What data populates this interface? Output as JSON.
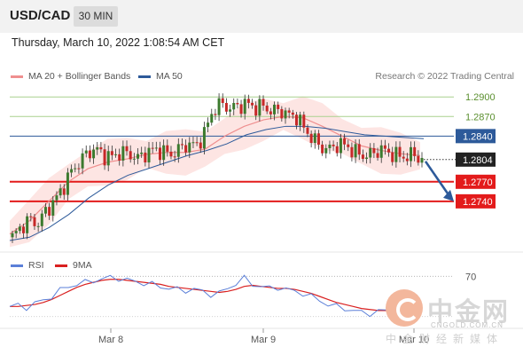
{
  "header": {
    "symbol": "USD/CAD",
    "timeframe": "30 MIN"
  },
  "datetime": "Thursday, March 10, 2022 1:08:54 AM CET",
  "legend": {
    "ma20_label": "MA 20 + Bollinger Bands",
    "ma50_label": "MA 50",
    "rsi_label": "RSI",
    "rsi_ma_label": "9MA"
  },
  "credit": "Research © 2022 Trading Central",
  "watermark": {
    "cn": "中金网",
    "site": "CNGOLD.COM.CN",
    "sub": "中金财经新媒体"
  },
  "colors": {
    "ma20": "#ef8f8f",
    "ma50": "#2d5a9a",
    "bollinger_fill": "#fde0de",
    "resistance_green": "#a9d18e",
    "support_red": "#e31b1b",
    "level_blue": "#2d5a9a",
    "rsi": "#5b7fd8",
    "rsi_ma": "#d92020",
    "arrow": "#2d5a9a"
  },
  "chart_data": [
    {
      "type": "candlestick",
      "title": "USD/CAD 30 MIN",
      "x_tick_labels": [
        "Mar 8",
        "Mar 9",
        "Mar 10"
      ],
      "ylim": [
        1.2665,
        1.2918
      ],
      "last_price": 1.2804,
      "levels": [
        {
          "value": 1.29,
          "label": "1.2900",
          "role": "resistance",
          "color": "#a9d18e"
        },
        {
          "value": 1.287,
          "label": "1.2870",
          "role": "resistance",
          "color": "#a9d18e"
        },
        {
          "value": 1.284,
          "label": "1.2840",
          "role": "pivot",
          "color": "#2d5a9a"
        },
        {
          "value": 1.277,
          "label": "1.2770",
          "role": "support",
          "color": "#e31b1b"
        },
        {
          "value": 1.274,
          "label": "1.2740",
          "role": "support",
          "color": "#e31b1b"
        }
      ],
      "price_path": [
        1.2685,
        1.27,
        1.2712,
        1.2705,
        1.2725,
        1.274,
        1.276,
        1.2785,
        1.28,
        1.2815,
        1.282,
        1.281,
        1.2808,
        1.2816,
        1.2812,
        1.2806,
        1.2814,
        1.282,
        1.2816,
        1.2812,
        1.282,
        1.2828,
        1.2825,
        1.2845,
        1.288,
        1.289,
        1.2882,
        1.2886,
        1.289,
        1.2884,
        1.2886,
        1.2878,
        1.288,
        1.2872,
        1.287,
        1.285,
        1.2835,
        1.2822,
        1.282,
        1.2828,
        1.2825,
        1.2815,
        1.281,
        1.2812,
        1.282,
        1.2815,
        1.281,
        1.2808,
        1.2812,
        1.2804
      ],
      "ma20_path": [
        1.269,
        1.271,
        1.274,
        1.277,
        1.279,
        1.28,
        1.2805,
        1.2812,
        1.2815,
        1.2815,
        1.282,
        1.284,
        1.2855,
        1.2865,
        1.287,
        1.2868,
        1.2855,
        1.284,
        1.2825,
        1.2818,
        1.2813,
        1.281
      ],
      "ma50_path": [
        1.268,
        1.2685,
        1.27,
        1.272,
        1.2745,
        1.2765,
        1.278,
        1.279,
        1.28,
        1.281,
        1.2818,
        1.2828,
        1.2842,
        1.285,
        1.2855,
        1.2855,
        1.2852,
        1.2847,
        1.2842,
        1.284,
        1.2838,
        1.2836
      ],
      "forecast_arrow": {
        "from": 1.2804,
        "to": 1.274
      }
    },
    {
      "type": "line",
      "title": "RSI",
      "series": [
        {
          "name": "RSI"
        },
        {
          "name": "9MA"
        }
      ],
      "ylim": [
        20,
        80
      ],
      "levels": [
        {
          "value": 70,
          "label": "70"
        }
      ],
      "rsi_values": [
        40,
        41,
        39,
        43,
        46,
        50,
        56,
        60,
        62,
        64,
        66,
        67,
        69,
        68,
        66,
        65,
        63,
        62,
        60,
        58,
        57,
        56,
        57,
        55,
        52,
        53,
        58,
        63,
        68,
        62,
        60,
        58,
        59,
        57,
        55,
        53,
        50,
        46,
        42,
        40,
        38,
        36,
        34,
        33,
        35,
        36,
        37,
        38,
        36,
        34
      ],
      "rsi_ma_values": [
        40,
        40,
        41,
        42,
        44,
        47,
        51,
        55,
        59,
        62,
        64,
        66,
        67,
        67,
        66,
        65,
        64,
        63,
        62,
        60,
        59,
        58,
        57,
        56,
        55,
        54,
        55,
        57,
        60,
        61,
        60,
        59,
        58,
        58,
        57,
        55,
        53,
        50,
        47,
        44,
        42,
        40,
        38,
        37,
        36,
        36,
        36,
        37,
        37,
        36
      ]
    }
  ]
}
